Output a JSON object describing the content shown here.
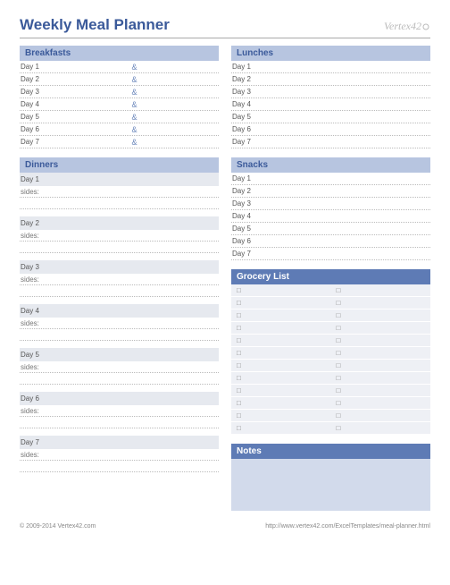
{
  "header": {
    "title": "Weekly Meal Planner",
    "brand": "Vertex42"
  },
  "breakfasts": {
    "title": "Breakfasts",
    "days": [
      "Day 1",
      "Day 2",
      "Day 3",
      "Day 4",
      "Day 5",
      "Day 6",
      "Day 7"
    ],
    "amp": "&"
  },
  "lunches": {
    "title": "Lunches",
    "days": [
      "Day 1",
      "Day 2",
      "Day 3",
      "Day 4",
      "Day 5",
      "Day 6",
      "Day 7"
    ]
  },
  "dinners": {
    "title": "Dinners",
    "sides_label": "sides:",
    "days": [
      "Day 1",
      "Day 2",
      "Day 3",
      "Day 4",
      "Day 5",
      "Day 6",
      "Day 7"
    ]
  },
  "snacks": {
    "title": "Snacks",
    "days": [
      "Day 1",
      "Day 2",
      "Day 3",
      "Day 4",
      "Day 5",
      "Day 6",
      "Day 7"
    ]
  },
  "grocery": {
    "title": "Grocery List",
    "bullet": "□",
    "rows": 12
  },
  "notes": {
    "title": "Notes"
  },
  "footer": {
    "copyright": "© 2009-2014 Vertex42.com",
    "url": "http://www.vertex42.com/ExcelTemplates/meal-planner.html"
  }
}
